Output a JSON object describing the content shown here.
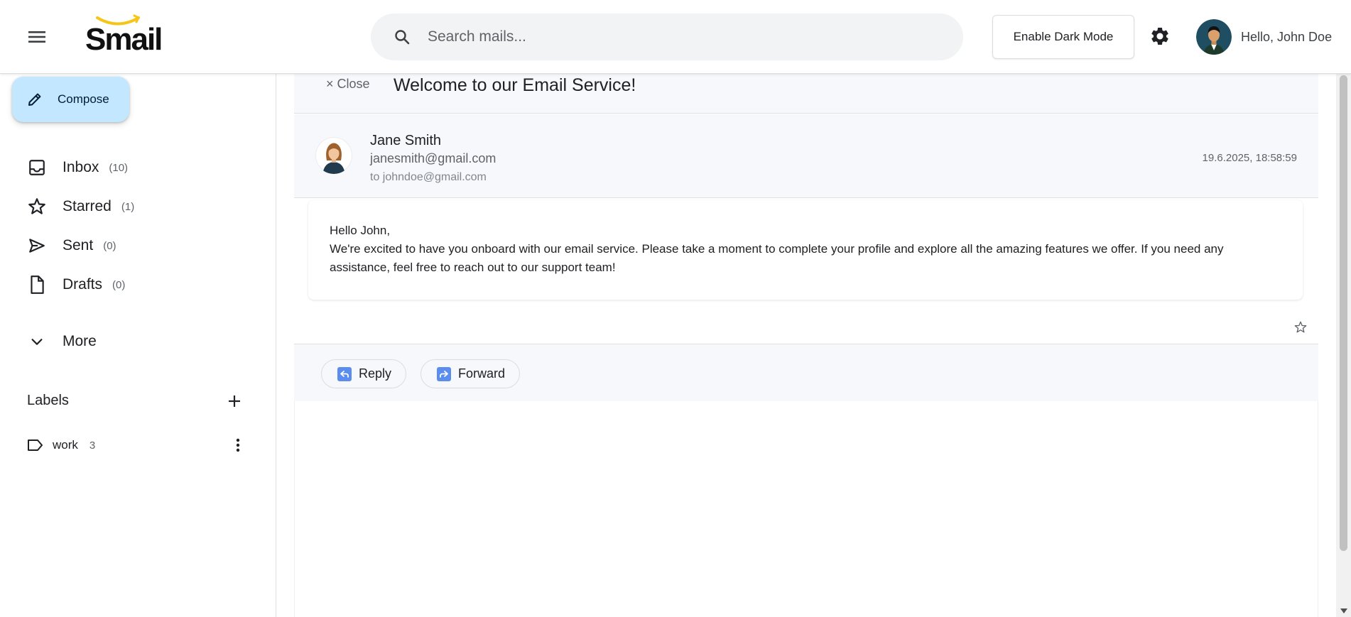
{
  "header": {
    "logo_text": "Smail",
    "search_placeholder": "Search mails...",
    "dark_mode_label": "Enable Dark Mode",
    "greeting": "Hello, John Doe"
  },
  "sidebar": {
    "compose_label": "Compose",
    "items": [
      {
        "label": "Inbox",
        "count": "(10)",
        "icon": "inbox-icon"
      },
      {
        "label": "Starred",
        "count": "(1)",
        "icon": "star-icon"
      },
      {
        "label": "Sent",
        "count": "(0)",
        "icon": "send-icon"
      },
      {
        "label": "Drafts",
        "count": "(0)",
        "icon": "draft-icon"
      }
    ],
    "more_label": "More",
    "labels_title": "Labels",
    "labels": [
      {
        "name": "work",
        "count": "3"
      }
    ]
  },
  "mail": {
    "close_label": "× Close",
    "subject": "Welcome to our Email Service!",
    "sender_name": "Jane Smith",
    "sender_email": "janesmith@gmail.com",
    "to_line": "to johndoe@gmail.com",
    "date": "19.6.2025, 18:58:59",
    "greeting_line": "Hello John,",
    "body": "We're excited to have you onboard with our email service. Please take a moment to complete your profile and explore all the amazing features we offer. If you need any assistance, feel free to reach out to our support team!",
    "reply_label": "Reply",
    "forward_label": "Forward"
  },
  "colors": {
    "compose_bg": "#c2e7ff",
    "header_panel_bg": "#f6f8fc",
    "logo_smile": "#f5c518",
    "action_icon": "#5b8def"
  }
}
